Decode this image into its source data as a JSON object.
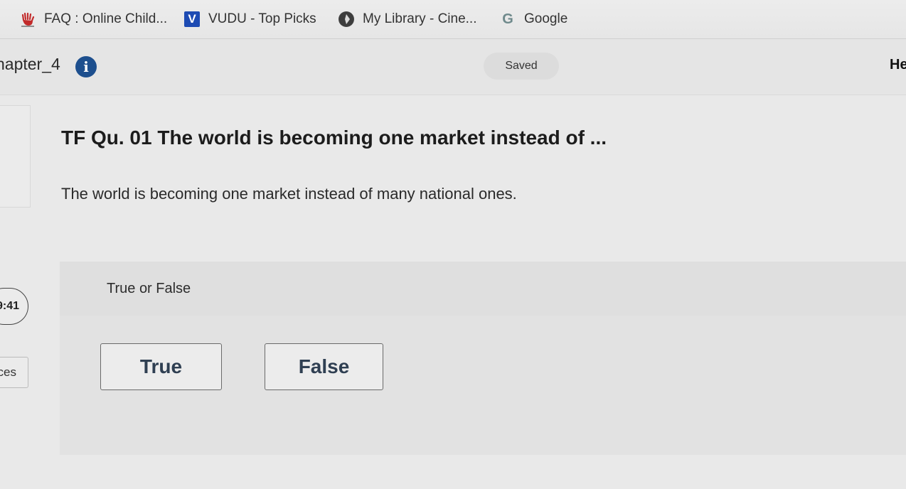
{
  "bookmarks": [
    {
      "label": "FAQ : Online Child...",
      "icon": "hand-icon"
    },
    {
      "label": "VUDU - Top Picks",
      "icon": "vudu-icon",
      "icon_text": "V"
    },
    {
      "label": "My Library - Cine...",
      "icon": "library-icon"
    },
    {
      "label": "Google",
      "icon": "google-icon",
      "icon_text": "G"
    }
  ],
  "header": {
    "chapter_title": "hapter_4",
    "info_icon_text": "i",
    "saved_label": "Saved",
    "right_text": "He"
  },
  "question": {
    "title": "TF Qu. 01 The world is becoming one market instead of ...",
    "text": "The world is becoming one market instead of many national ones."
  },
  "answer": {
    "prompt": "True or False",
    "options": [
      "True",
      "False"
    ]
  },
  "side": {
    "timer": "9:41",
    "resources_label": "ces"
  },
  "colors": {
    "accent": "#1d4f8e",
    "vudu": "#1d4bb3"
  }
}
